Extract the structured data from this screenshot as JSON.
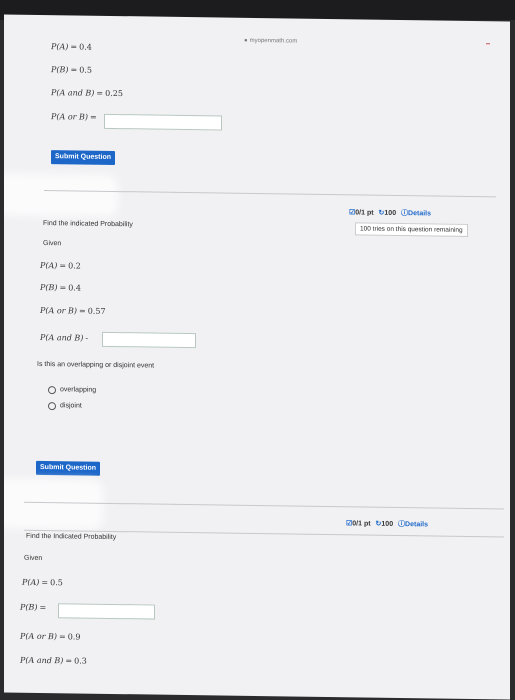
{
  "browser": {
    "url": "myopenmath.com"
  },
  "q1": {
    "lines": [
      {
        "lhs": "P(A)",
        "rhs": "0.4"
      },
      {
        "lhs": "P(B)",
        "rhs": "0.5"
      },
      {
        "lhs": "P(A and B)",
        "rhs": "0.25"
      }
    ],
    "answer_label": "P(A or B)",
    "answer_value": "",
    "submit_label": "Submit Question"
  },
  "q2": {
    "meta": {
      "score": "0/1 pt",
      "retries": "100",
      "details": "Details"
    },
    "tries_text": "100 tries on this question remaining",
    "instruction": "Find the indicated Probability",
    "given_label": "Given",
    "lines": [
      {
        "lhs": "P(A)",
        "rhs": "0.2"
      },
      {
        "lhs": "P(B)",
        "rhs": "0.4"
      },
      {
        "lhs": "P(A or B)",
        "rhs": "0.57"
      }
    ],
    "answer_label": "P(A and B)",
    "answer_value": "",
    "event_question": "Is this an overlapping or disjoint event",
    "options": [
      "overlapping",
      "disjoint"
    ],
    "submit_label": "Submit Question"
  },
  "q3": {
    "meta": {
      "score": "0/1 pt",
      "retries": "100",
      "details": "Details"
    },
    "instruction": "Find the Indicated Probability",
    "given_label": "Given",
    "line_a": {
      "lhs": "P(A)",
      "rhs": "0.5"
    },
    "answer_label": "P(B)",
    "answer_value": "",
    "lines": [
      {
        "lhs": "P(A or B)",
        "rhs": "0.9"
      },
      {
        "lhs": "P(A and B)",
        "rhs": "0.3"
      }
    ]
  },
  "colors": {
    "accent": "#1d67c9",
    "background": "#f1f1f3"
  }
}
